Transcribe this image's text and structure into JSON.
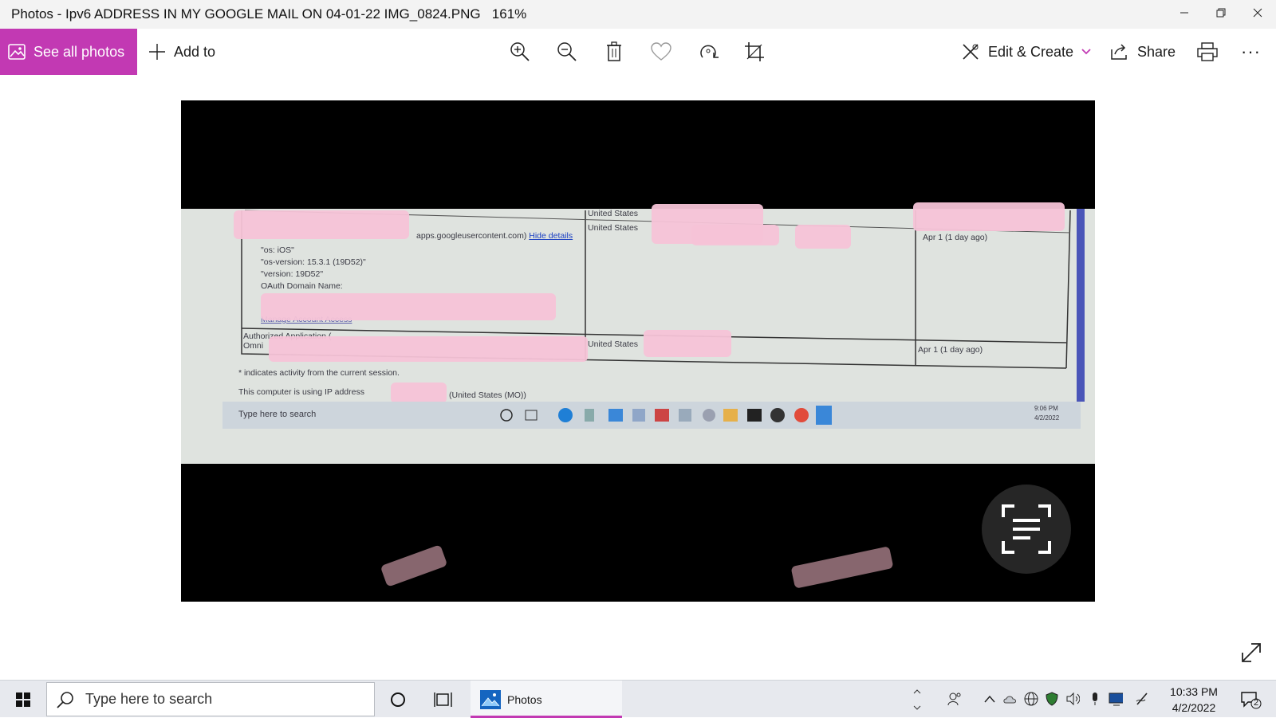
{
  "window": {
    "title": "Photos - Ipv6 ADDRESS IN MY GOOGLE MAIL ON 04-01-22 IMG_0824.PNG",
    "zoom": "161%"
  },
  "toolbar": {
    "see_all_label": "See all photos",
    "add_to_label": "Add to",
    "edit_create_label": "Edit & Create",
    "share_label": "Share",
    "more_label": "···",
    "accent_color": "#c239b3"
  },
  "photo_content": {
    "link_text": "apps.googleusercontent.com)",
    "hide_details": "Hide details",
    "lines": [
      "\"os: iOS\"",
      "\"os-version: 15.3.1 (19D52)\"",
      "\"version: 19D52\"",
      "OAuth Domain Name:",
      "Authorized Application (",
      "Omni",
      "* indicates activity from the current session.",
      "This computer is using IP address"
    ],
    "country_1": "United States",
    "country_2": "United States",
    "country_3": "United States",
    "date_1": "Apr 1 (1 day ago)",
    "date_2": "Apr 1 (1 day ago)",
    "ip_suffix": "(United States (MO))",
    "manage_link": "Manage Account Access",
    "inner_search": "Type here to search",
    "inner_time": "9:06 PM",
    "inner_date": "4/2/2022"
  },
  "taskbar": {
    "search_placeholder": "Type here to search",
    "app_label": "Photos",
    "time": "10:33 PM",
    "date": "4/2/2022",
    "notification_count": "2"
  }
}
